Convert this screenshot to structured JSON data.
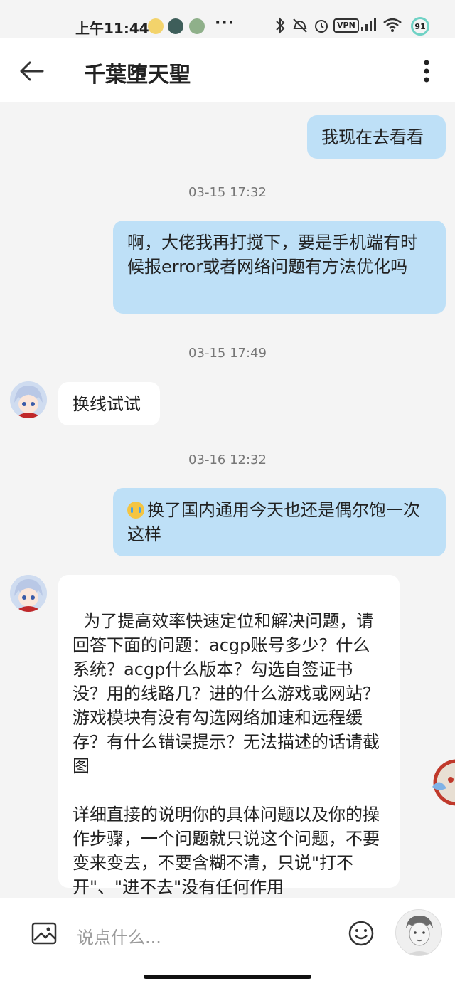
{
  "status_bar": {
    "time": "上午11:44",
    "vpn": "VPN",
    "battery": "91",
    "more": "···"
  },
  "header": {
    "title": "千葉堕天聖"
  },
  "messages": [
    {
      "direction": "out",
      "text": "我现在去看看"
    },
    {
      "timestamp": "03-15 17:32"
    },
    {
      "direction": "out",
      "text": "啊，大佬我再打搅下，要是手机端有时候报error或者网络问题有方法优化吗"
    },
    {
      "timestamp": "03-15 17:49"
    },
    {
      "direction": "in",
      "text": "换线试试"
    },
    {
      "timestamp": "03-16 12:32"
    },
    {
      "direction": "out",
      "emoji": "crying-face",
      "text": "换了国内通用今天也还是偶尔饱一次这样"
    },
    {
      "direction": "in",
      "text": "为了提高效率快速定位和解决问题，请回答下面的问题：acgp账号多少？什么系统？acgp什么版本？勾选自签证书没？用的线路几？进的什么游戏或网站？游戏模块有没有勾选网络加速和远程缓存？有什么错误提示？无法描述的话请截图\n\n详细直接的说明你的具体问题以及你的操作步骤，一个问题就只说这个问题，不要变来变去，不要含糊不清，只说\"打不开\"、\"进不去\"没有任何作用"
    }
  ],
  "input": {
    "placeholder": "说点什么..."
  },
  "colors": {
    "outgoing_bubble": "#bee0f7",
    "incoming_bubble": "#ffffff",
    "background": "#f4f4f4"
  }
}
